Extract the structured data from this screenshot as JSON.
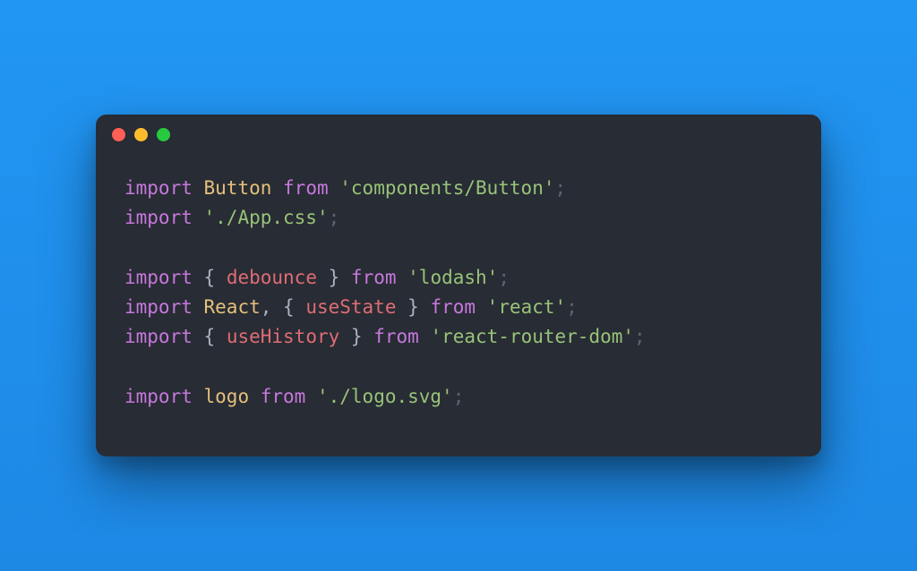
{
  "colors": {
    "background": "#2196f3",
    "editor": "#282c34",
    "close": "#ff5f56",
    "minimize": "#ffbd2e",
    "maximize": "#27c93f",
    "keyword": "#c678dd",
    "default_name": "#e5c07b",
    "named_import": "#e06c75",
    "string": "#98c379",
    "punctuation": "#abb2bf",
    "semicolon": "#5c6370"
  },
  "code": {
    "l1": {
      "kw": "import",
      "def": "Button",
      "from": "from",
      "str": "'components/Button'",
      "semi": ";"
    },
    "l2": {
      "kw": "import",
      "str": "'./App.css'",
      "semi": ";"
    },
    "l3": "",
    "l4": {
      "kw": "import",
      "ob": "{ ",
      "name": "debounce",
      "cb": " }",
      "from": "from",
      "str": "'lodash'",
      "semi": ";"
    },
    "l5": {
      "kw": "import",
      "def": "React",
      "comma": ", ",
      "ob": "{ ",
      "name": "useState",
      "cb": " }",
      "from": "from",
      "str": "'react'",
      "semi": ";"
    },
    "l6": {
      "kw": "import",
      "ob": "{ ",
      "name": "useHistory",
      "cb": " }",
      "from": "from",
      "str": "'react-router-dom'",
      "semi": ";"
    },
    "l7": "",
    "l8": {
      "kw": "import",
      "def": "logo",
      "from": "from",
      "str": "'./logo.svg'",
      "semi": ";"
    }
  }
}
